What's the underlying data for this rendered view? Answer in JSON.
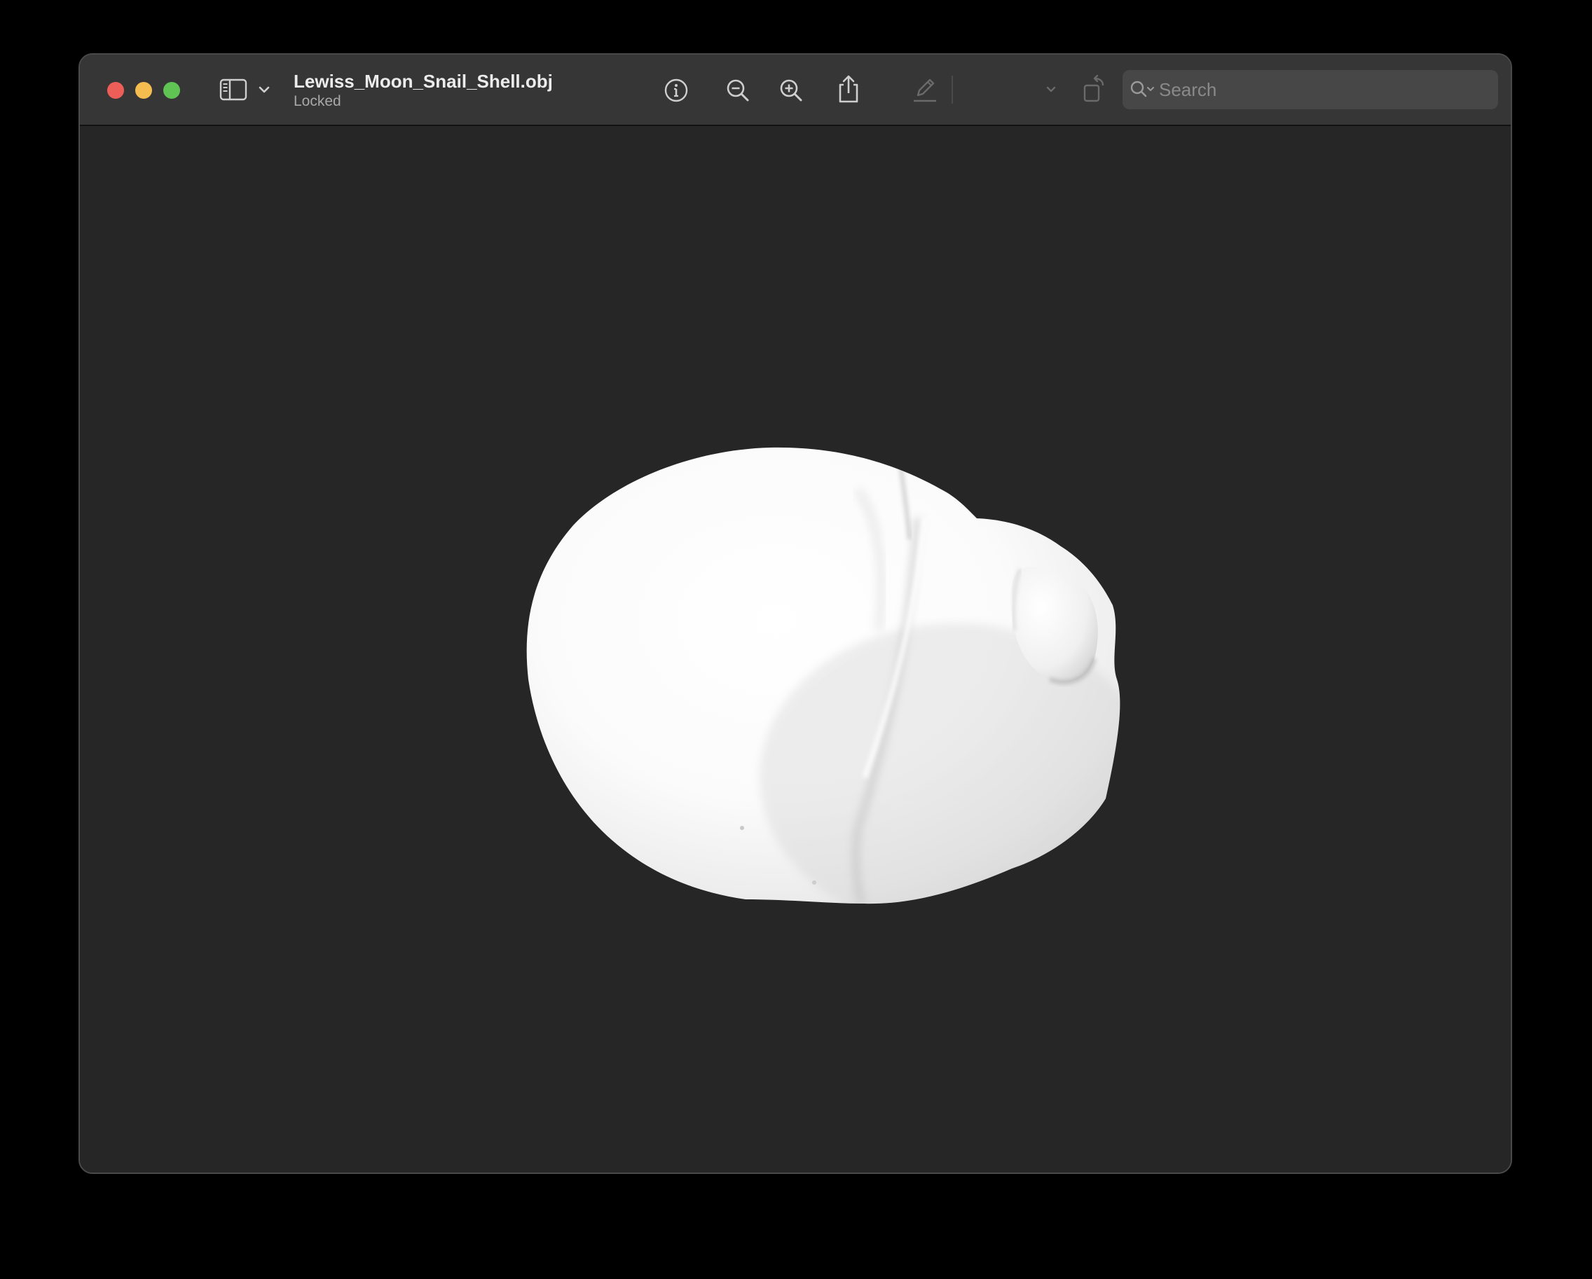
{
  "window": {
    "title": "Lewiss_Moon_Snail_Shell.obj",
    "subtitle": "Locked"
  },
  "toolbar": {
    "traffic_lights": {
      "close_color": "#ee5e59",
      "minimize_color": "#f5bd4f",
      "zoom_color": "#5fc454"
    },
    "icons": [
      "sidebar-toggle-icon",
      "chevron-down-icon",
      "info-icon",
      "zoom-out-icon",
      "zoom-in-icon",
      "share-icon",
      "markup-pen-icon",
      "chevron-down-icon",
      "rotate-icon",
      "annotate-icon"
    ]
  },
  "search": {
    "placeholder": "Search",
    "value": ""
  },
  "viewer": {
    "content": "3D model render of a white moon snail shell",
    "background_color": "#262626",
    "model_color": "#ffffff"
  }
}
